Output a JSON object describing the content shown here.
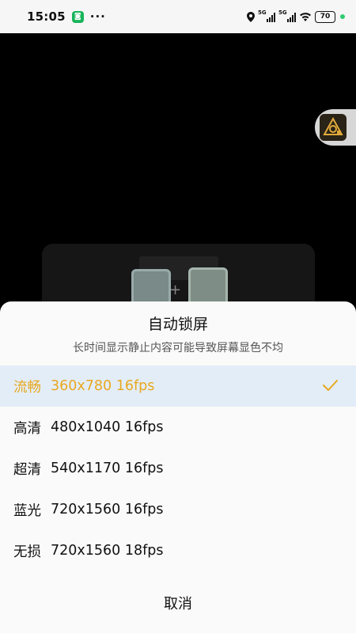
{
  "status_bar": {
    "time": "15:05",
    "app_badge": "◙",
    "more": "···",
    "network_1": "5G",
    "network_2": "5G",
    "battery": "70"
  },
  "sheet": {
    "title": "自动锁屏",
    "subtitle": "长时间显示静止内容可能导致屏幕显色不均",
    "options": [
      {
        "name": "流畅",
        "spec": "360x780 16fps",
        "selected": true
      },
      {
        "name": "高清",
        "spec": "480x1040 16fps",
        "selected": false
      },
      {
        "name": "超清",
        "spec": "540x1170 16fps",
        "selected": false
      },
      {
        "name": "蓝光",
        "spec": "720x1560 16fps",
        "selected": false
      },
      {
        "name": "无损",
        "spec": "720x1560 18fps",
        "selected": false
      }
    ],
    "cancel_label": "取消"
  },
  "colors": {
    "accent": "#e8a820",
    "selected_bg": "#e3edf8",
    "sheet_bg": "#fafafa"
  }
}
